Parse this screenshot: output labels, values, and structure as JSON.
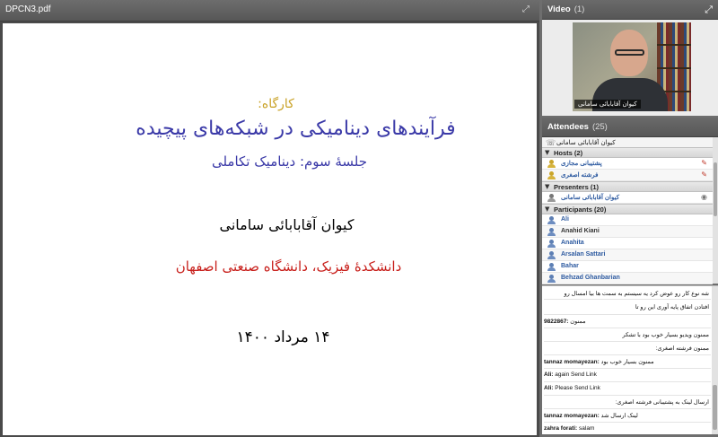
{
  "document": {
    "filename": "DPCN3.pdf",
    "slide": {
      "workshop": "کارگاه:",
      "title": "فرآیندهای دینامیکی در شبکه‌های پیچیده",
      "session": "جلسهٔ سوم: دینامیک تکاملی",
      "author": "کیوان آقابابائی سامانی",
      "affiliation": "دانشکدهٔ فیزیک، دانشگاه صنعتی اصفهان",
      "date": "۱۴ مرداد ۱۴۰۰"
    }
  },
  "video": {
    "label": "Video",
    "count": "(1)",
    "caption": "کیوان آقابابائی سامانی"
  },
  "attendees": {
    "label": "Attendees",
    "count": "(25)",
    "me": "کیوان آقابابائی سامانی",
    "hosts": {
      "label": "Hosts (2)",
      "items": [
        "پشتیبانی مجازی",
        "فرشته اصغری"
      ]
    },
    "presenters": {
      "label": "Presenters (1)",
      "items": [
        "کیوان آقابابائی سامانی"
      ]
    },
    "participants": {
      "label": "Participants (20)",
      "items": [
        "Ali",
        "Anahid Kiani",
        "Anahita",
        "Arsalan Sattari",
        "Bahar",
        "Behzad Ghanbarian"
      ]
    }
  },
  "chat": {
    "messages": [
      {
        "sender": "",
        "text": "شه نوع کار رو عوض کرد یه سیستم به سمت ها بیا امسال رو"
      },
      {
        "sender": "",
        "text": "افتادن اتفاق پایه آوری این رو تا"
      },
      {
        "sender": "9822867:",
        "text": "ممنون"
      },
      {
        "sender": "",
        "text": "ممنون ویدیو بسیار خوب بود با تشکر"
      },
      {
        "sender": "",
        "text": "ممنون فرشته اصغری:"
      },
      {
        "sender": "tannaz momayezan:",
        "text": "ممنون بسیار خوب بود"
      },
      {
        "sender": "Ali:",
        "text": "again Send Link"
      },
      {
        "sender": "Ali:",
        "text": "Please Send Link"
      },
      {
        "sender": "",
        "text": "ارسال لینک به پشتیبانی فرشته اصغری:"
      },
      {
        "sender": "tannaz momayezan:",
        "text": "لینک ارسال شد"
      },
      {
        "sender": "zahra forati:",
        "text": "salam"
      }
    ]
  },
  "colors": {
    "slide_title": "#3b3aa8",
    "slide_workshop": "#c9a227",
    "slide_affiliation": "#c8201c",
    "header_bg": "#5e5e5e"
  }
}
